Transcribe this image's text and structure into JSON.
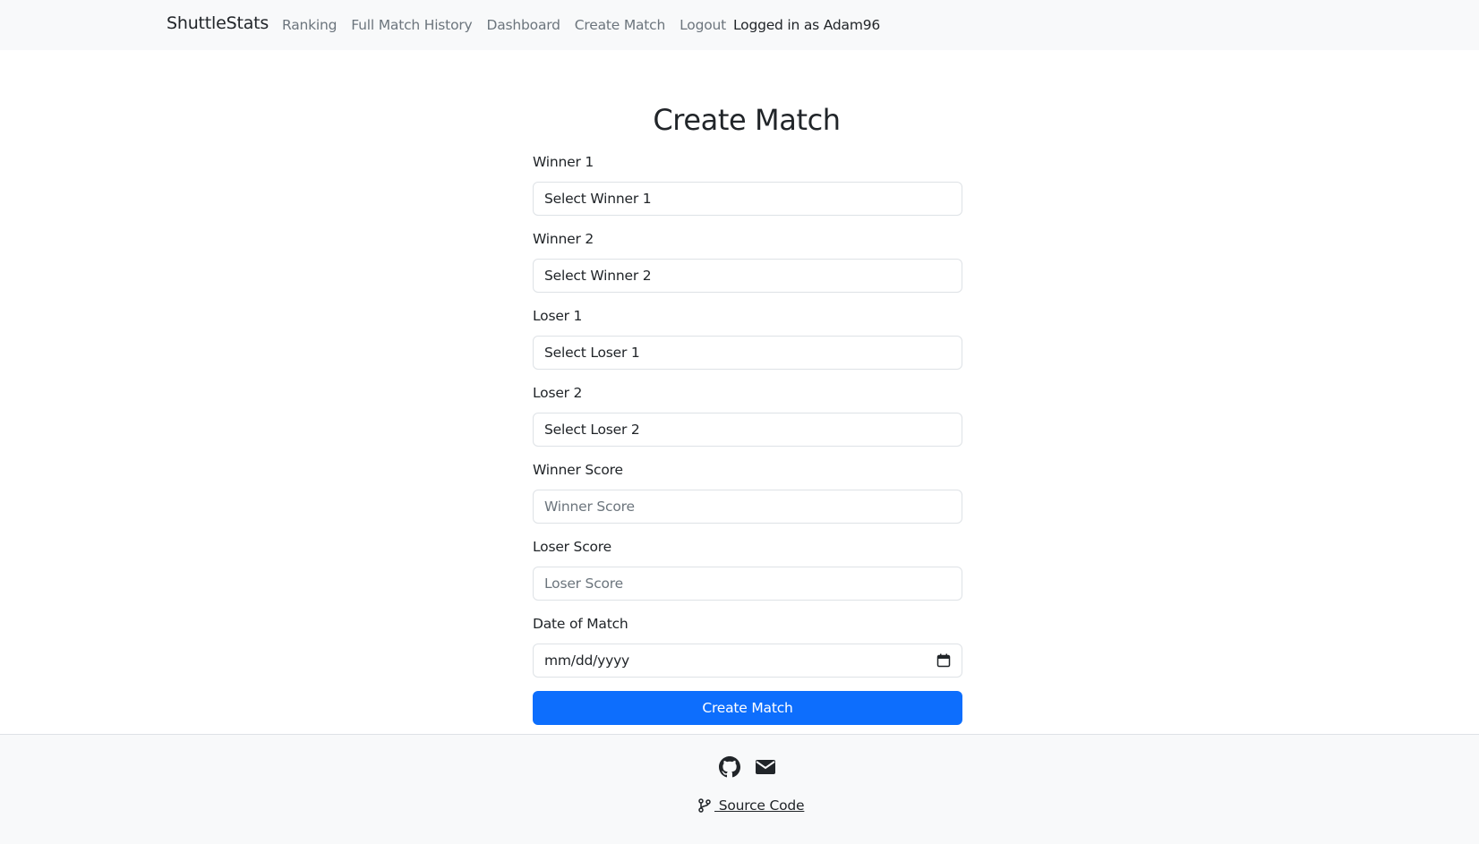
{
  "nav": {
    "brand": "ShuttleStats",
    "links": [
      "Ranking",
      "Full Match History",
      "Dashboard",
      "Create Match",
      "Logout"
    ],
    "logged_in": "Logged in as Adam96"
  },
  "page_title": "Create Match",
  "form": {
    "fields": [
      {
        "label": "Winner 1",
        "value": "Select Winner 1"
      },
      {
        "label": "Winner 2",
        "value": "Select Winner 2"
      },
      {
        "label": "Loser 1",
        "value": "Select Loser 1"
      },
      {
        "label": "Loser 2",
        "value": "Select Loser 2"
      },
      {
        "label": "Winner Score",
        "placeholder": "Winner Score"
      },
      {
        "label": "Loser Score",
        "placeholder": "Loser Score"
      },
      {
        "label": "Date of Match",
        "placeholder": "mm/dd/yyyy"
      }
    ],
    "submit_label": "Create Match"
  },
  "footer": {
    "icons": [
      "github-icon",
      "envelope-icon"
    ],
    "source_label": " Source Code",
    "source_icon": "git-branch-icon"
  },
  "colors": {
    "primary": "#0d6efd",
    "navbar_bg": "#f8f9fa",
    "footer_bg": "#f8f9fa"
  }
}
